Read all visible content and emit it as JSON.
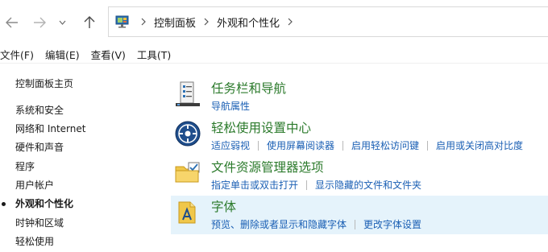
{
  "nav": {
    "back_glyph": "←",
    "forward_glyph": "→",
    "recent_glyph": "⌄",
    "up_glyph": "↑"
  },
  "address": {
    "crumbs": [
      "控制面板",
      "外观和个性化"
    ]
  },
  "menu": {
    "items": [
      "文件(F)",
      "编辑(E)",
      "查看(V)",
      "工具(T)"
    ]
  },
  "sidebar": {
    "home": "控制面板主页",
    "items": [
      {
        "label": "系统和安全"
      },
      {
        "label": "网络和 Internet"
      },
      {
        "label": "硬件和声音"
      },
      {
        "label": "程序"
      },
      {
        "label": "用户帐户"
      },
      {
        "label": "外观和个性化",
        "active": true
      },
      {
        "label": "时钟和区域"
      },
      {
        "label": "轻松使用"
      }
    ]
  },
  "categories": [
    {
      "title": "任务栏和导航",
      "icon": "taskbar-icon",
      "links": [
        "导航属性"
      ]
    },
    {
      "title": "轻松使用设置中心",
      "icon": "ease-of-access-icon",
      "links": [
        "适应弱视",
        "使用屏幕阅读器",
        "启用轻松访问键",
        "启用或关闭高对比度"
      ]
    },
    {
      "title": "文件资源管理器选项",
      "icon": "folder-options-icon",
      "links": [
        "指定单击或双击打开",
        "显示隐藏的文件和文件夹"
      ]
    },
    {
      "title": "字体",
      "icon": "fonts-icon",
      "links": [
        "预览、删除或者显示和隐藏字体",
        "更改字体设置"
      ],
      "hover": true
    }
  ],
  "colors": {
    "category_title": "#2b7a2b",
    "link": "#1a5fb4",
    "hover_bg": "#e5f3fb"
  }
}
